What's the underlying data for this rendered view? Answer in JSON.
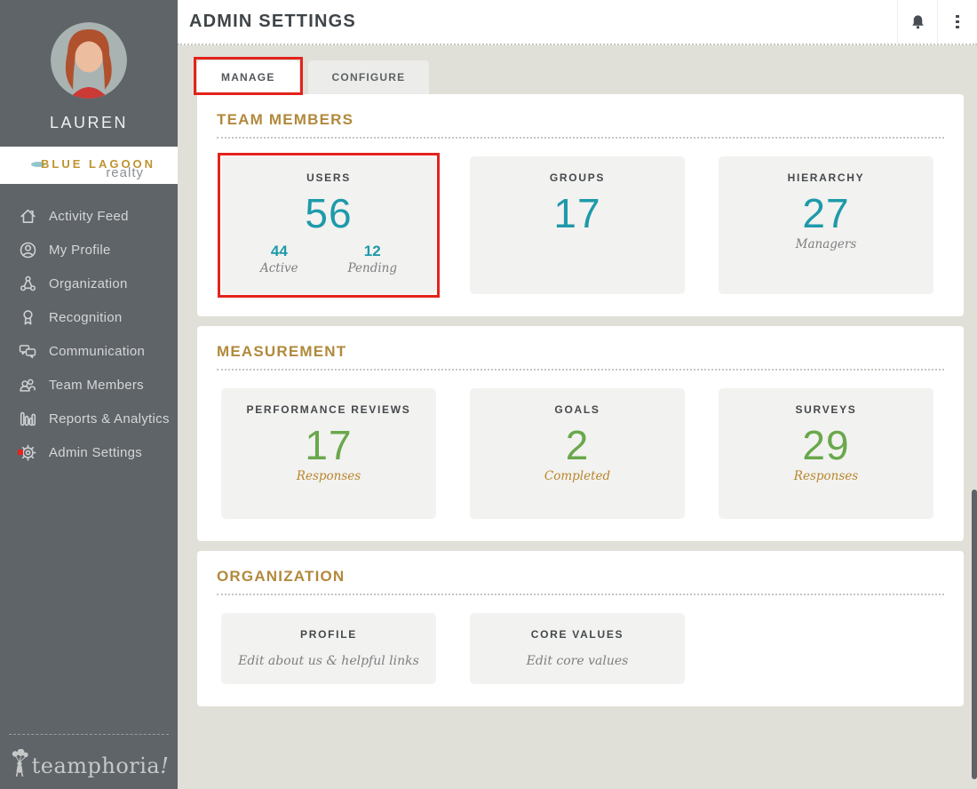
{
  "colors": {
    "accent_teal": "#1e9aaa",
    "accent_green": "#69a84c",
    "accent_gold": "#b1893c",
    "annotation_red": "#e3231c",
    "sidebar_bg": "#5f6468"
  },
  "header": {
    "title": "ADMIN SETTINGS",
    "icons": [
      {
        "name": "bell-icon"
      },
      {
        "name": "kebab-icon"
      }
    ]
  },
  "sidebar": {
    "user_name": "LAUREN",
    "brand": {
      "primary": "BLUE LAGOON",
      "secondary": "realty"
    },
    "nav_items": [
      {
        "icon": "home-icon",
        "label": "Activity Feed"
      },
      {
        "icon": "profile-icon",
        "label": "My Profile"
      },
      {
        "icon": "organization-icon",
        "label": "Organization"
      },
      {
        "icon": "recognition-icon",
        "label": "Recognition"
      },
      {
        "icon": "communication-icon",
        "label": "Communication"
      },
      {
        "icon": "team-members-icon",
        "label": "Team Members"
      },
      {
        "icon": "reports-icon",
        "label": "Reports & Analytics"
      },
      {
        "icon": "gear-icon",
        "label": "Admin Settings",
        "annotated": true
      }
    ],
    "footer_logo_text": "teamphoria"
  },
  "tabs": [
    {
      "label": "MANAGE",
      "active": true,
      "annotated": true
    },
    {
      "label": "CONFIGURE",
      "active": false
    }
  ],
  "sections": [
    {
      "title": "TEAM MEMBERS",
      "cards": [
        {
          "title": "USERS",
          "value": "56",
          "value_color": "teal",
          "annotated": true,
          "substats": [
            {
              "value": "44",
              "label": "Active"
            },
            {
              "value": "12",
              "label": "Pending"
            }
          ]
        },
        {
          "title": "GROUPS",
          "value": "17",
          "value_color": "teal"
        },
        {
          "title": "HIERARCHY",
          "value": "27",
          "value_color": "teal",
          "sublabel": {
            "text": "Managers",
            "color": "gray"
          }
        }
      ]
    },
    {
      "title": "MEASUREMENT",
      "cards": [
        {
          "title": "PERFORMANCE REVIEWS",
          "value": "17",
          "value_color": "green",
          "sublabel": {
            "text": "Responses",
            "color": "gold"
          }
        },
        {
          "title": "GOALS",
          "value": "2",
          "value_color": "green",
          "sublabel": {
            "text": "Completed",
            "color": "gold"
          }
        },
        {
          "title": "SURVEYS",
          "value": "29",
          "value_color": "green",
          "sublabel": {
            "text": "Responses",
            "color": "gold"
          }
        }
      ]
    },
    {
      "title": "ORGANIZATION",
      "cards": [
        {
          "title": "PROFILE",
          "sublabel": {
            "text": "Edit about us & helpful links",
            "color": "gray"
          }
        },
        {
          "title": "CORE VALUES",
          "sublabel": {
            "text": "Edit core values",
            "color": "gray"
          }
        }
      ]
    }
  ]
}
